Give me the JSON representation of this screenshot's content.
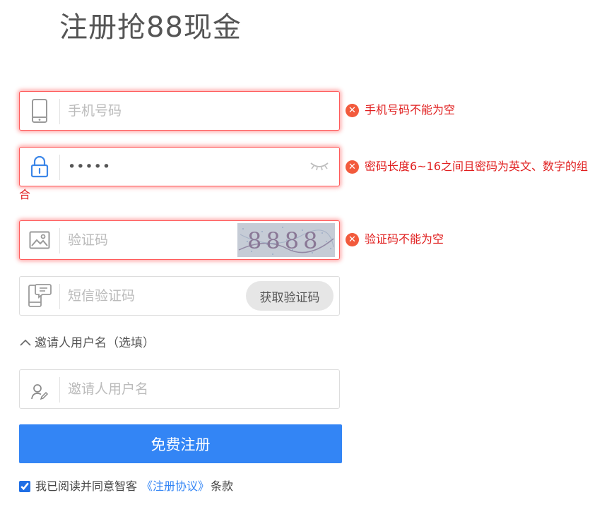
{
  "page": {
    "title": "注册抢88现金"
  },
  "phone": {
    "placeholder": "手机号码",
    "value": "",
    "error": "手机号码不能为空"
  },
  "password": {
    "value": "•••••",
    "error_line1": "密码长度6~16之间且密码为英文、数字的组",
    "error_line2": "合"
  },
  "captcha": {
    "placeholder": "验证码",
    "image_text": "8888",
    "error": "验证码不能为空"
  },
  "sms": {
    "placeholder": "短信验证码",
    "button_label": "获取验证码"
  },
  "invite": {
    "toggle_label": "邀请人用户名（选填）",
    "placeholder": "邀请人用户名"
  },
  "submit": {
    "label": "免费注册"
  },
  "agreement": {
    "checked": true,
    "prefix": "我已阅读并同意智客",
    "link": "《注册协议》",
    "suffix": "条款"
  },
  "colors": {
    "primary": "#3385f5",
    "error": "#e01e1e",
    "error_icon": "#f25a3c"
  },
  "icons": {
    "phone": "phone-icon",
    "password": "lock-icon",
    "captcha": "image-icon",
    "sms": "sms-phone-icon",
    "invite": "user-edit-icon",
    "eye": "eye-closed-icon",
    "error": "error-circle-icon",
    "toggle": "chevron-up-icon"
  }
}
